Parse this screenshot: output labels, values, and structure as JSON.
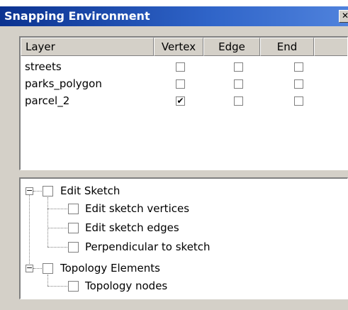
{
  "window": {
    "title": "Snapping Environment",
    "close_glyph": "✕"
  },
  "layers": {
    "columns": [
      "Layer",
      "Vertex",
      "Edge",
      "End"
    ],
    "rows": [
      {
        "name": "streets",
        "vertex": false,
        "edge": false,
        "end": false
      },
      {
        "name": "parks_polygon",
        "vertex": false,
        "edge": false,
        "end": false
      },
      {
        "name": "parcel_2",
        "vertex": true,
        "edge": false,
        "end": false
      }
    ]
  },
  "tree": {
    "groups": [
      {
        "label": "Edit Sketch",
        "expanded": true,
        "checked": false,
        "children": [
          {
            "label": "Edit sketch vertices",
            "checked": false
          },
          {
            "label": "Edit sketch edges",
            "checked": false
          },
          {
            "label": "Perpendicular to sketch",
            "checked": false
          }
        ]
      },
      {
        "label": "Topology Elements",
        "expanded": true,
        "checked": false,
        "children": [
          {
            "label": "Topology nodes",
            "checked": false
          }
        ]
      }
    ],
    "expander_glyph": "−"
  }
}
